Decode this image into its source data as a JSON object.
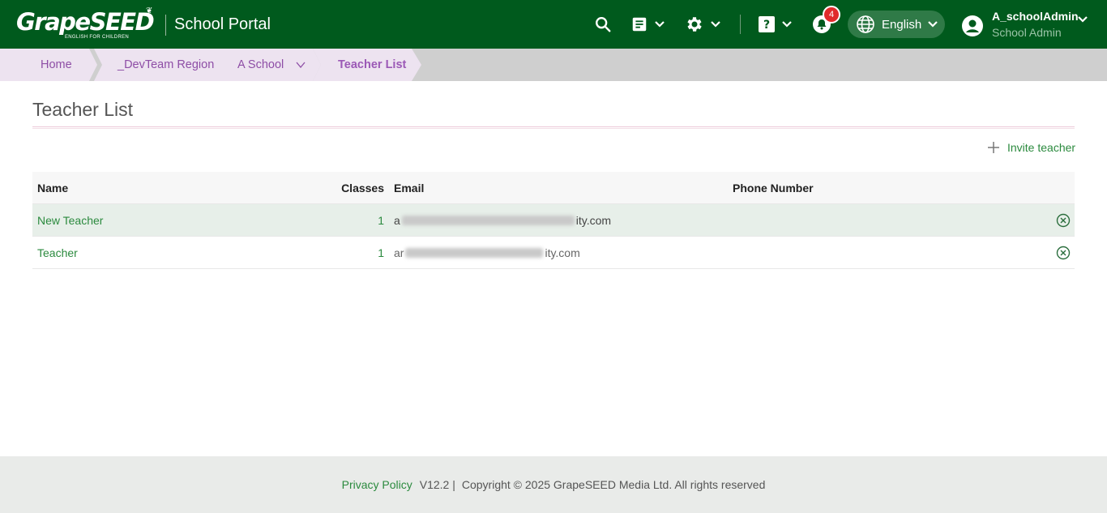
{
  "header": {
    "logo_text": "GrapeSEED",
    "logo_tagline": "ENGLISH FOR CHILDREN",
    "portal_title": "School Portal",
    "notification_count": "4",
    "language": "English",
    "user_name": "A_schoolAdmin",
    "user_role": "School Admin",
    "colors": {
      "bar": "#005a1d",
      "badge": "#e02b2b",
      "lang_pill": "#2f7a47"
    }
  },
  "breadcrumb": {
    "items": [
      {
        "label": "Home"
      },
      {
        "label": "_DevTeam Region"
      },
      {
        "label": "A School"
      },
      {
        "label": "Teacher List"
      }
    ]
  },
  "page": {
    "title": "Teacher List",
    "invite_label": "Invite teacher"
  },
  "table": {
    "columns": [
      "Name",
      "Classes",
      "Email",
      "Phone Number"
    ],
    "rows": [
      {
        "name": "New Teacher",
        "classes": "1",
        "email_prefix": "a",
        "email_suffix": "ity.com",
        "phone": ""
      },
      {
        "name": "Teacher",
        "classes": "1",
        "email_prefix": "ar",
        "email_suffix": "ity.com",
        "phone": ""
      }
    ]
  },
  "footer": {
    "privacy": "Privacy Policy",
    "version": "V12.2 |",
    "copyright": "Copyright © 2025 GrapeSEED Media Ltd. All rights reserved"
  }
}
